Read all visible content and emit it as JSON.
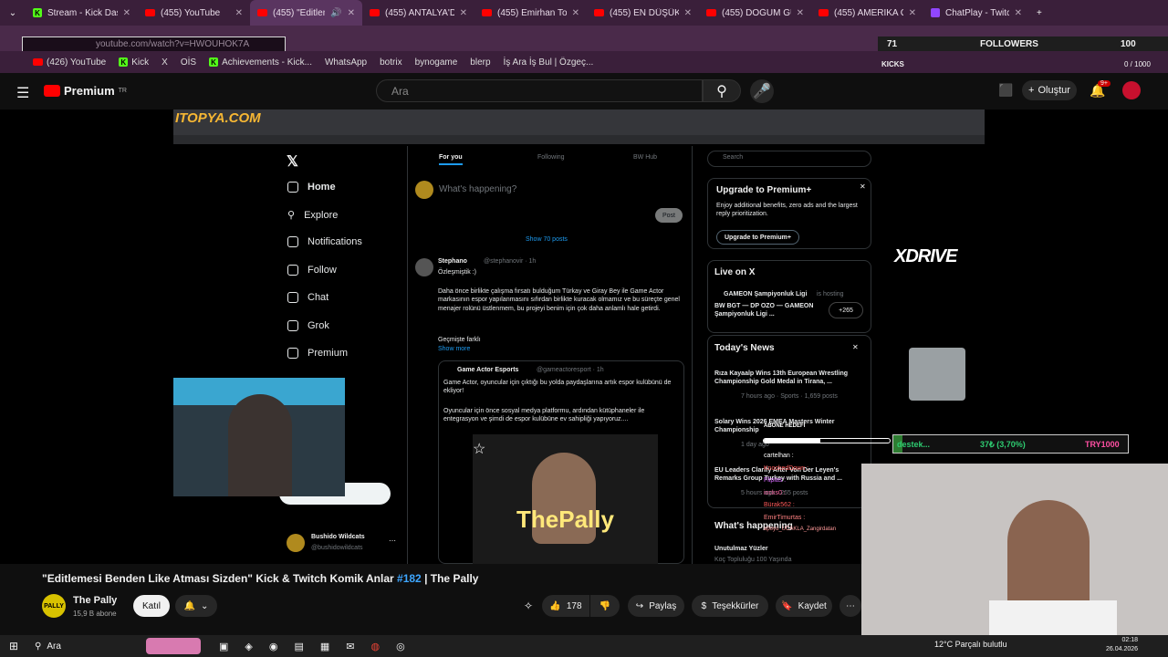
{
  "tabs": [
    {
      "label": "Stream - Kick Dashb",
      "fav": "kick"
    },
    {
      "label": "(455) YouTube",
      "fav": "yt"
    },
    {
      "label": "(455) \"Editleme",
      "fav": "yt"
    },
    {
      "label": "(455) ANTALYA'DA R",
      "fav": "yt"
    },
    {
      "label": "(455) Emirhan Topçu",
      "fav": "yt"
    },
    {
      "label": "(455) EN DÜŞÜK PUA",
      "fav": "yt"
    },
    {
      "label": "(455) DOĞUM GÜNÜ",
      "fav": "yt"
    },
    {
      "label": "(455) AMERİKA GEC",
      "fav": "yt"
    },
    {
      "label": "ChatPlay - Twitch & ",
      "fav": "tw"
    }
  ],
  "address": {
    "url": "youtube.com/watch?v=HWOUHOK7A"
  },
  "bookmarks": [
    "(426) YouTube",
    "Kick",
    "X",
    "OİS",
    "Achievements - Kick...",
    "WhatsApp",
    "botrix",
    "bynogame",
    "blerp",
    "İş Ara İş Bul | Özgeç..."
  ],
  "yt_header": {
    "brand": "Premium",
    "brand_sup": "TR",
    "search_placeholder": "Ara",
    "create_label": "Oluştur",
    "notif_count": "9+"
  },
  "overlay": {
    "followers_count": "71",
    "followers_label": "FOLLOWERS",
    "followers_goal": "100",
    "kicks_label": "KICKS",
    "kicks_progress": "0 / 1000",
    "logo": "XDRIVE",
    "donation_name": "destek...",
    "donation_progress": "37₺ (3,70%)",
    "donation_goal": "TRY1000",
    "watermark": "ITOPYA.COM"
  },
  "x": {
    "nav": [
      "Home",
      "Explore",
      "Notifications",
      "Follow",
      "Chat",
      "Grok",
      "Premium"
    ],
    "tabs": [
      "For you",
      "Following",
      "BW Hub"
    ],
    "compose": "What's happening?",
    "post_btn": "Post",
    "show_posts": "Show 70 posts",
    "post": {
      "author": "Stephano",
      "handle": "@stephanovir · 1h",
      "line1": "Özleşmiştik :)",
      "body": "Daha önce birlikte çalışma fırsatı bulduğum Türkay ve Giray Bey ile Game Actor markasının espor yapılanmasını sıfırdan birlikte kuracak olmamız ve bu süreçte genel menajer rolünü üstlenmem, bu projeyi benim için çok daha anlamlı hale getirdi.",
      "past": "Geçmişte farklı",
      "show_more": "Show more"
    },
    "quote": {
      "author": "Game Actor Esports",
      "handle": "@gameactoresport · 1h",
      "body1": "Game Actor, oyuncular için çıktığı bu yolda paydaşlarına artık espor kulübünü de ekliyor!",
      "body2": "Oyuncular için önce sosyal medya platformu, ardından kütüphaneler ile entegrasyon ve şimdi de espor kulübüne ev sahipliği yapıyoruz...."
    },
    "media_text": "ThePally",
    "search": "Search",
    "premium": {
      "title": "Upgrade to Premium+",
      "desc": "Enjoy additional benefits, zero ads and the largest reply prioritization.",
      "btn": "Upgrade to Premium+"
    },
    "live": {
      "title": "Live on X",
      "host": "GAMEON Şampiyonluk Ligi",
      "hosting": "is hosting",
      "desc": "BW BGT — DP OZO — GAMEON Şampiyonluk Ligi ...",
      "count": "+265"
    },
    "news": {
      "title": "Today's News",
      "items": [
        {
          "h": "Rıza Kayaalp Wins 13th European Wrestling Championship Gold Medal in Tirana, ...",
          "m": "7 hours ago · Sports · 1,659 posts"
        },
        {
          "h": "Solary Wins 2026 EMEA Masters Winter Championship",
          "m": "1 day ago"
        },
        {
          "h": "EU Leaders Clarify After Von Der Leyen's Remarks Group Turkey with Russia and ...",
          "m": "5 hours ago · 265 posts"
        }
      ]
    },
    "happening": "What's happening",
    "trend": "Unutulmaz Yüzler",
    "trend2": "Koç Topluluğu 100 Yaşında",
    "account": {
      "name": "Bushido Wildcats",
      "handle": "@bushidowildcats"
    }
  },
  "chat": {
    "goal_label": "ABONE HEDEFİ",
    "messages": [
      "cartelhan :",
      "KnockedDown :",
      "Fliplas :",
      "iocks0 :",
      "Bürak562 :",
      "EmirTimurtas :",
      "apoyu_UCAKLA_Zangirdatan"
    ]
  },
  "video": {
    "title_main": "\"Editlemesi Benden Like Atması Sizden\" Kick & Twitch Komik Anlar",
    "title_tag": "#182",
    "title_tail": "| The Pally",
    "channel": "The Pally",
    "subs": "15,9 B abone",
    "join": "Katıl",
    "likes": "178",
    "share": "Paylaş",
    "thanks": "Teşekkürler",
    "save": "Kaydet"
  },
  "taskbar": {
    "search": "Ara",
    "weather": "12°C Parçalı bulutlu",
    "time": "02:18",
    "date": "26.04.2026"
  }
}
